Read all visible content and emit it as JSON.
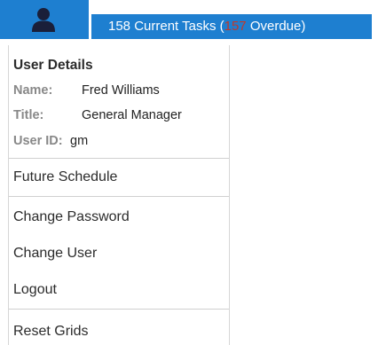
{
  "header": {
    "user_icon": "user-icon",
    "tasks_count": "158",
    "tasks_text": "Current Tasks (",
    "overdue_count": "157",
    "overdue_text": "Overdue)"
  },
  "user_details": {
    "title": "User Details",
    "name_label": "Name:",
    "name_value": "Fred Williams",
    "title_label": "Title:",
    "title_value": "General Manager",
    "userid_label": "User ID:",
    "userid_value": "gm"
  },
  "menu": {
    "future_schedule": "Future Schedule",
    "change_password": "Change Password",
    "change_user": "Change User",
    "logout": "Logout",
    "reset_grids": "Reset Grids"
  },
  "colors": {
    "brand_blue": "#1e7fd0",
    "overdue_red": "#c0392b"
  }
}
